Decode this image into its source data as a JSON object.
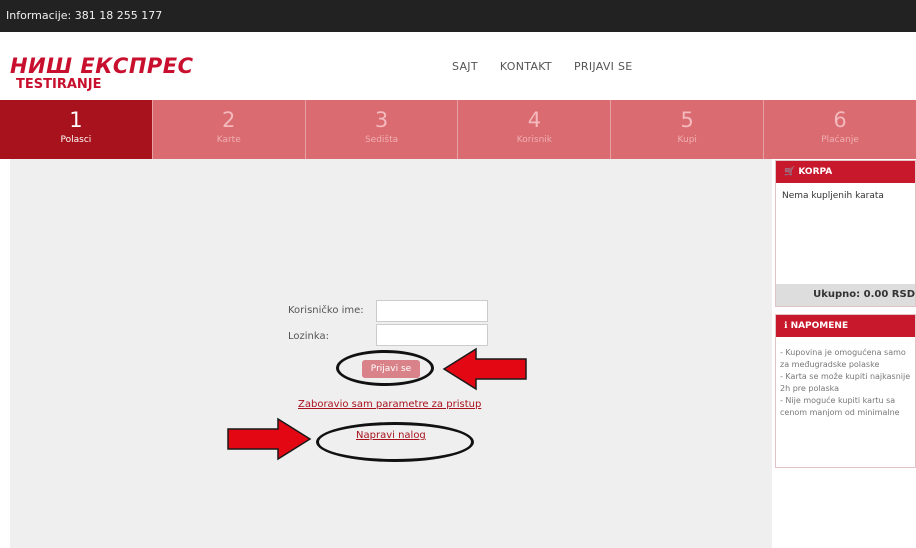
{
  "topbar": {
    "info": "Informacije: 381 18 255 177"
  },
  "logo": {
    "title": "НИШ ЕКСПРЕС",
    "subtitle": "TESTIRANJE"
  },
  "nav": [
    "SAJT",
    "KONTAKT",
    "PRIJAVI SE"
  ],
  "steps": [
    {
      "num": "1",
      "label": "Polasci",
      "active": true
    },
    {
      "num": "2",
      "label": "Karte",
      "active": false
    },
    {
      "num": "3",
      "label": "Sedišta",
      "active": false
    },
    {
      "num": "4",
      "label": "Korisnik",
      "active": false
    },
    {
      "num": "5",
      "label": "Kupi",
      "active": false
    },
    {
      "num": "6",
      "label": "Plaćanje",
      "active": false
    }
  ],
  "login": {
    "username_label": "Korisničko ime:",
    "username_value": "",
    "password_label": "Lozinka:",
    "password_value": "",
    "submit": "Prijavi se",
    "forgot": "Zaboravio sam parametre za pristup",
    "register": "Napravi nalog"
  },
  "cart": {
    "title": "KORPA",
    "empty": "Nema kupljenih karata",
    "total": "Ukupno: 0.00 RSD"
  },
  "notes": {
    "title": "NAPOMENE",
    "items": [
      "- Kupovina je omogućena samo za međugradske polaske",
      "- Karta se može kupiti najkasnije 2h pre polaska",
      "- Nije moguće kupiti kartu sa cenom manjom od minimalne"
    ]
  },
  "colors": {
    "brand": "#c8102e",
    "step_active": "#a8121c",
    "step_inactive": "#d96b71",
    "arrow": "#e30613"
  },
  "icons": {
    "cart": "cart-icon",
    "info": "info-icon",
    "arrow": "red-arrow-icon"
  }
}
